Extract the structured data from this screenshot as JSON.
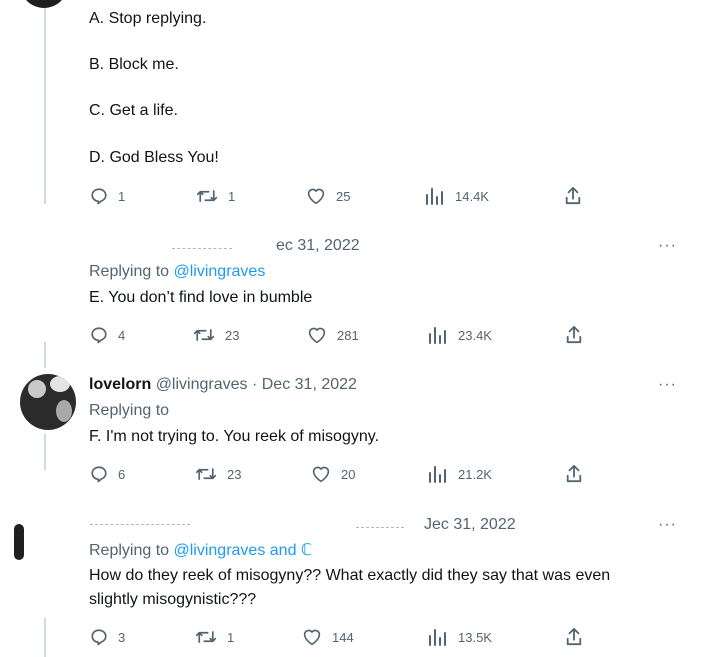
{
  "tweet1": {
    "lines": [
      "A. Stop replying.",
      "B. Block me.",
      "C. Get a life.",
      "D. God Bless You!"
    ],
    "actions": {
      "replies": "1",
      "retweets": "1",
      "likes": "25",
      "views": "14.4K"
    }
  },
  "tweet2": {
    "date_fragment": "ec 31, 2022",
    "replying_label": "Replying to",
    "replying_handle": "@livingraves",
    "body": "E. You don’t find love in bumble",
    "more": "···",
    "actions": {
      "replies": "4",
      "retweets": "23",
      "likes": "281",
      "views": "23.4K"
    }
  },
  "tweet3": {
    "name": "lovelorn",
    "handle": "@livingraves",
    "date": "· Dec 31, 2022",
    "replying_label": "Replying to",
    "body": "F. I'm not trying to. You reek of misogyny.",
    "more": "···",
    "actions": {
      "replies": "6",
      "retweets": "23",
      "likes": "20",
      "views": "21.2K"
    }
  },
  "tweet4": {
    "date_fragment": "Jec 31, 2022",
    "replying_label": "Replying to",
    "replying_handle": "@livingraves and ℂ",
    "body_line1": "How do they reek of misogyny?? What exactly did they say that was even",
    "body_line2": "slightly misogynistic???",
    "more": "···",
    "actions": {
      "replies": "3",
      "retweets": "1",
      "likes": "144",
      "views": "13.5K"
    }
  }
}
